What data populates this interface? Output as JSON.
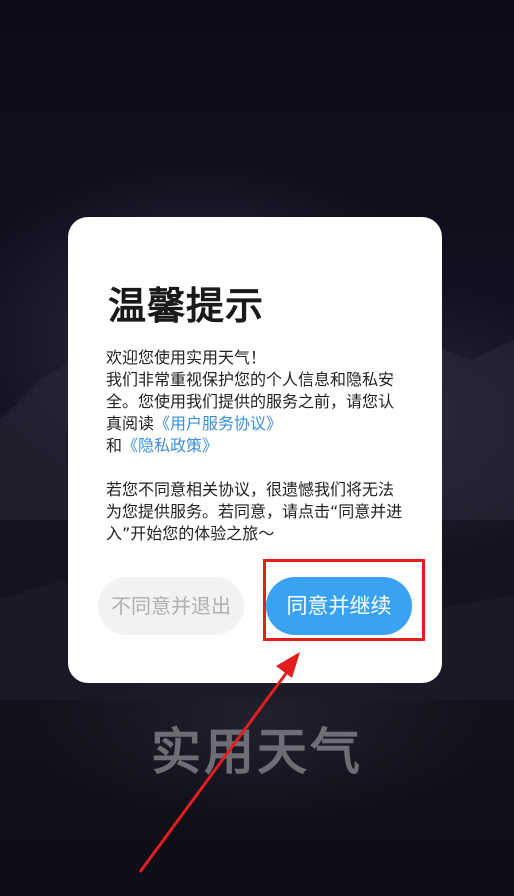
{
  "background": {
    "app_name": "实用天气"
  },
  "dialog": {
    "title": "温馨提示",
    "intro_line1": "欢迎您使用实用天气！",
    "intro_line2": "我们非常重视保护您的个人信息和隐私安全。您使用我们提供的服务之前，请您认真阅读",
    "link_terms": "《用户服务协议》",
    "conjunction": "和",
    "link_privacy": "《隐私政策》",
    "notice": "若您不同意相关协议，很遗憾我们将无法为您提供服务。若同意，请点击“同意并进入”开始您的体验之旅～",
    "decline_label": "不同意并退出",
    "accept_label": "同意并继续"
  },
  "colors": {
    "accent": "#3aa2f2",
    "link": "#3b8fd9",
    "annotation": "#e21e1e"
  }
}
